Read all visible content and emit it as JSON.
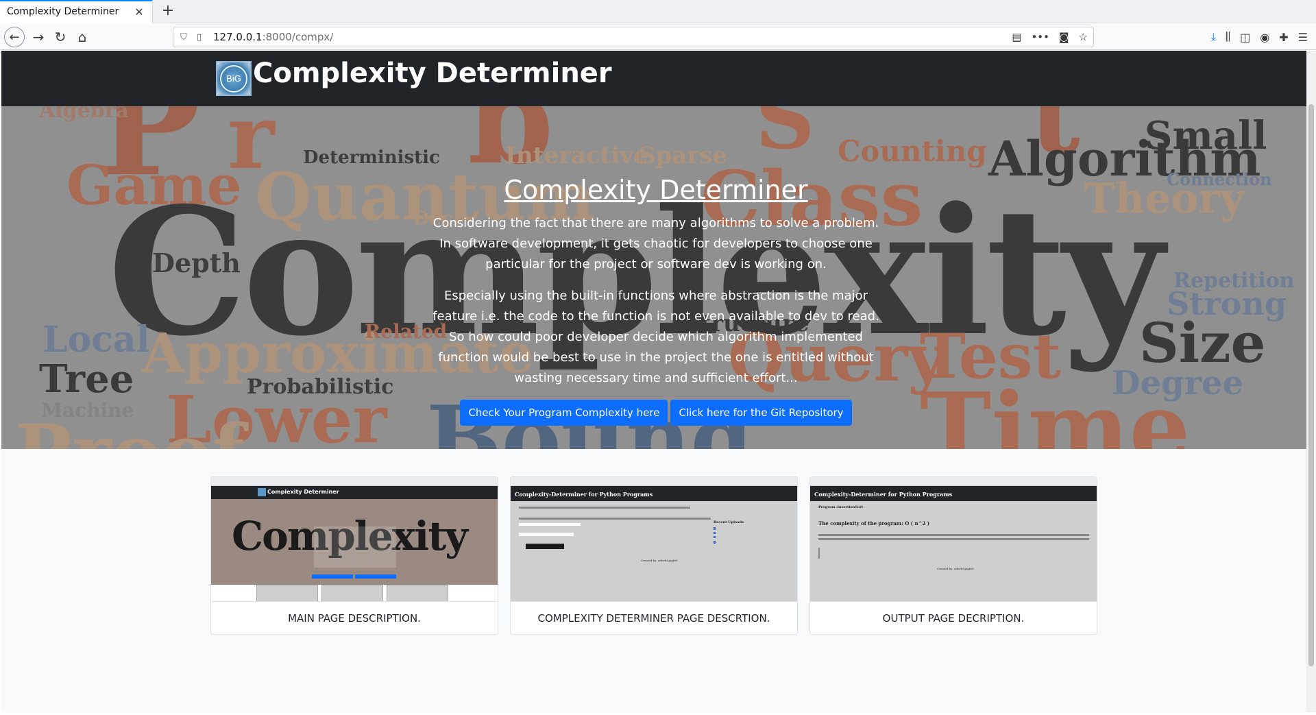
{
  "browser": {
    "tab_title": "Complexity Determiner",
    "url_host": "127.0.0.1",
    "url_path": ":8000/compx/"
  },
  "site": {
    "brand": "Complexity Determiner",
    "logo_text": "BiG"
  },
  "hero": {
    "title": "Complexity Determiner",
    "paragraph1": "Considering the fact that there are many algorithms to solve a problem. In software development, it gets chaotic for developers to choose one particular for the project or software dev is working on.",
    "paragraph2": "Especially using the built-in functions where abstraction is the major feature i.e. the code to the function is not even available to dev to read. So how could poor developer decide which algorithm implemented function would be best to use in the project the one is entitled without wasting necessary time and sufficient effort...",
    "btn_check": "Check Your Program Complexity here",
    "btn_git": "Click here for the Git Repository"
  },
  "cards": [
    {
      "caption": "MAIN PAGE DESCRIPTION."
    },
    {
      "caption": "COMPLEXITY DETERMINER PAGE DESCRTION."
    },
    {
      "caption": "OUTPUT PAGE DECRIPTION."
    }
  ],
  "mini": {
    "header_text": "Complexity-Determiner for Python Programs",
    "recent": "Recent Uploads",
    "program": "Program :insertionSort",
    "complexity": "The complexity of the program: O ( n^2 )",
    "credit": "Created by: adeeb&jaglit9"
  }
}
